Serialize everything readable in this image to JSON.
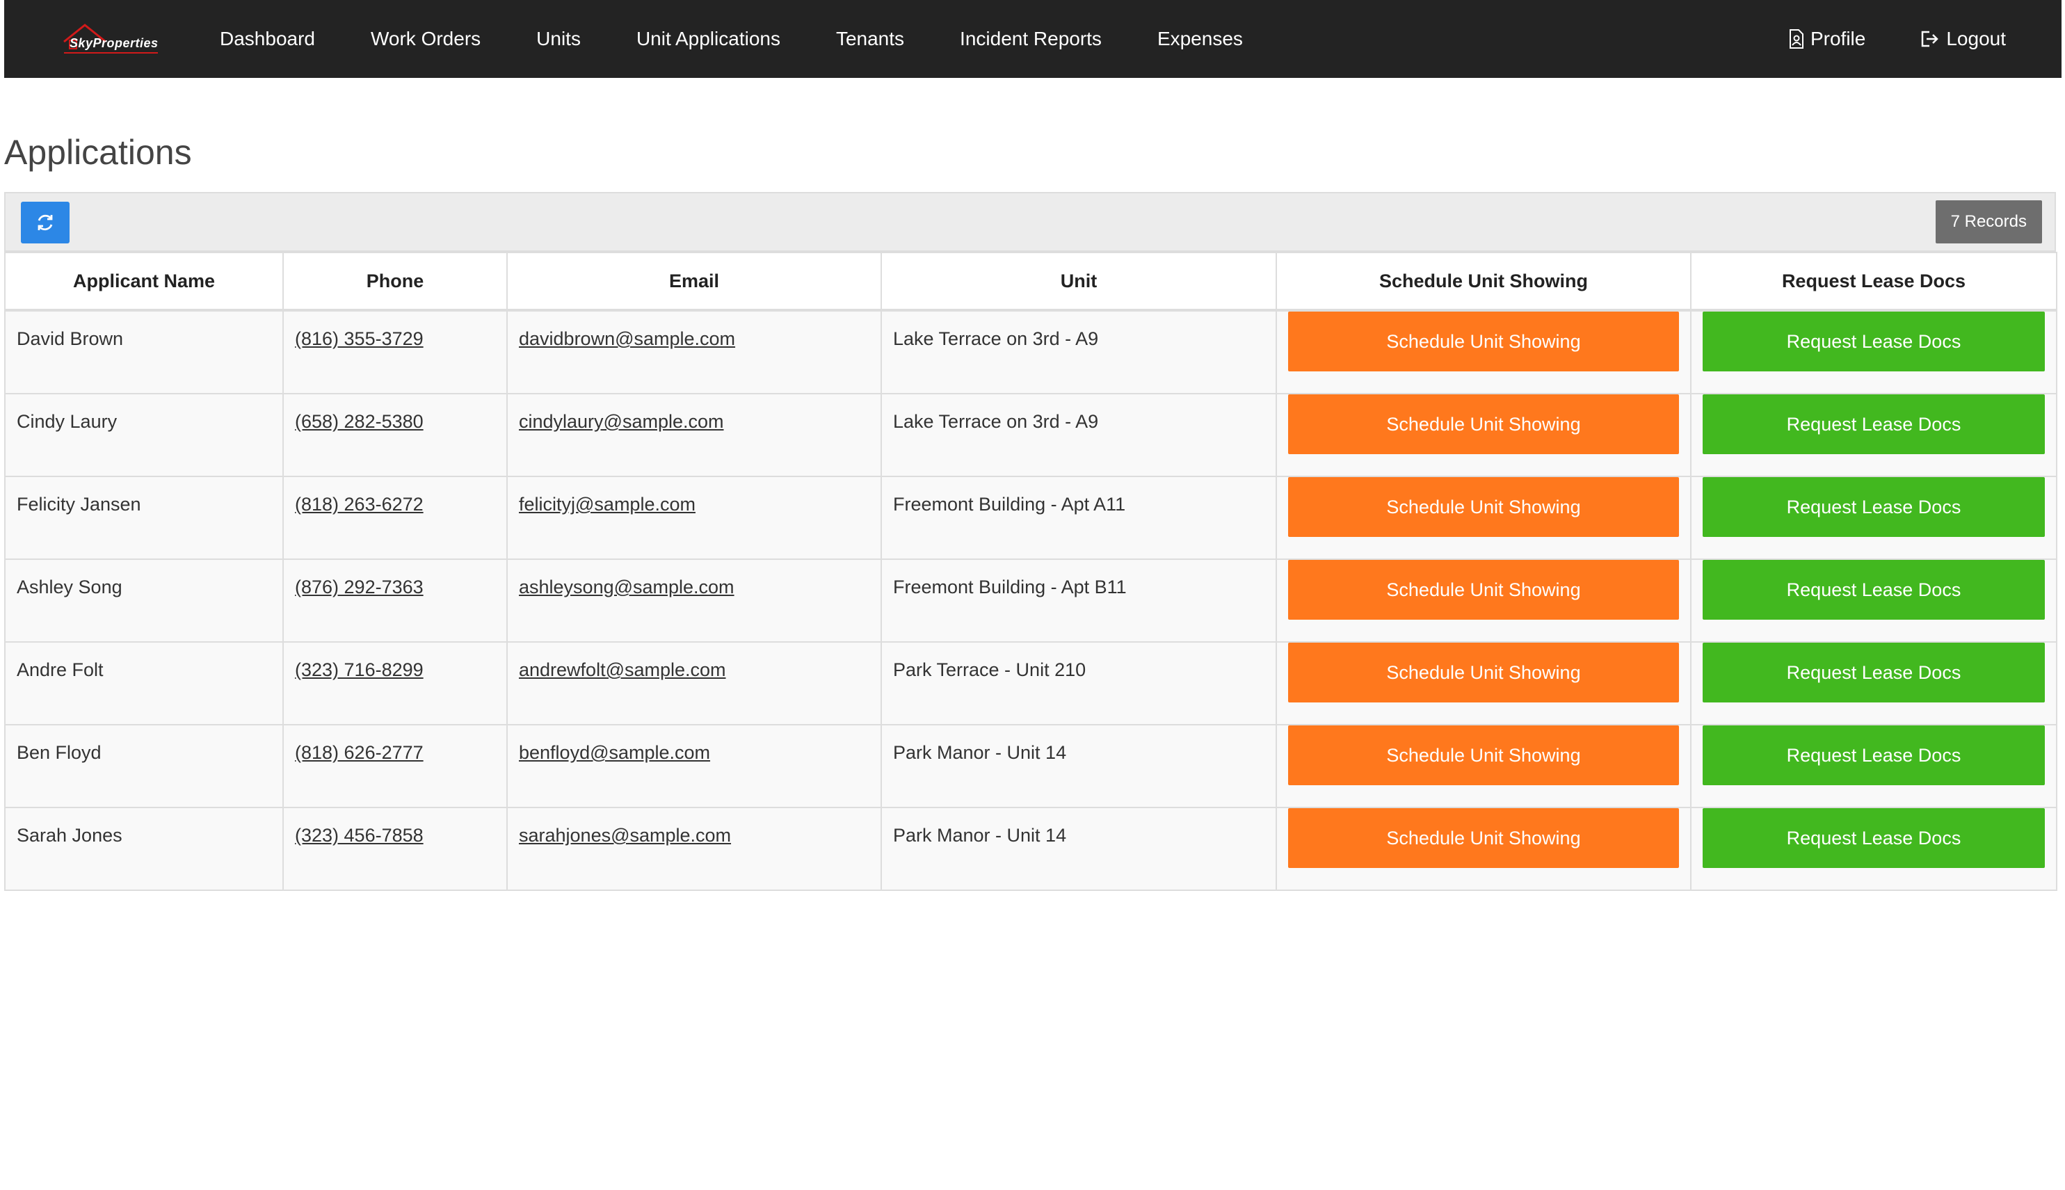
{
  "brand": {
    "logo_text": "SkyProperties"
  },
  "nav": {
    "items": [
      "Dashboard",
      "Work Orders",
      "Units",
      "Unit Applications",
      "Tenants",
      "Incident Reports",
      "Expenses"
    ],
    "profile": "Profile",
    "logout": "Logout"
  },
  "page": {
    "title": "Applications"
  },
  "toolbar": {
    "records": "7 Records"
  },
  "table": {
    "headers": [
      "Applicant Name",
      "Phone",
      "Email",
      "Unit",
      "Schedule Unit Showing",
      "Request Lease Docs"
    ],
    "schedule_label": "Schedule Unit Showing",
    "lease_label": "Request Lease Docs",
    "rows": [
      {
        "name": "David Brown",
        "phone": "(816) 355-3729",
        "email": "davidbrown@sample.com",
        "unit": "Lake Terrace on 3rd - A9"
      },
      {
        "name": "Cindy Laury",
        "phone": "(658) 282-5380",
        "email": "cindylaury@sample.com",
        "unit": "Lake Terrace on 3rd - A9"
      },
      {
        "name": "Felicity Jansen",
        "phone": "(818) 263-6272",
        "email": "felicityj@sample.com",
        "unit": "Freemont Building - Apt A11"
      },
      {
        "name": "Ashley Song",
        "phone": "(876) 292-7363",
        "email": "ashleysong@sample.com",
        "unit": "Freemont Building - Apt B11"
      },
      {
        "name": "Andre Folt",
        "phone": "(323) 716-8299",
        "email": "andrewfolt@sample.com",
        "unit": "Park Terrace - Unit 210"
      },
      {
        "name": "Ben Floyd",
        "phone": "(818) 626-2777",
        "email": "benfloyd@sample.com",
        "unit": "Park Manor - Unit 14"
      },
      {
        "name": "Sarah Jones",
        "phone": "(323) 456-7858",
        "email": "sarahjones@sample.com",
        "unit": "Park Manor - Unit 14"
      }
    ]
  },
  "colors": {
    "navbar": "#232323",
    "schedule_button": "#ff781d",
    "lease_button": "#42b81f",
    "refresh_button": "#2c87e6",
    "records_badge": "#6e6e6e"
  }
}
